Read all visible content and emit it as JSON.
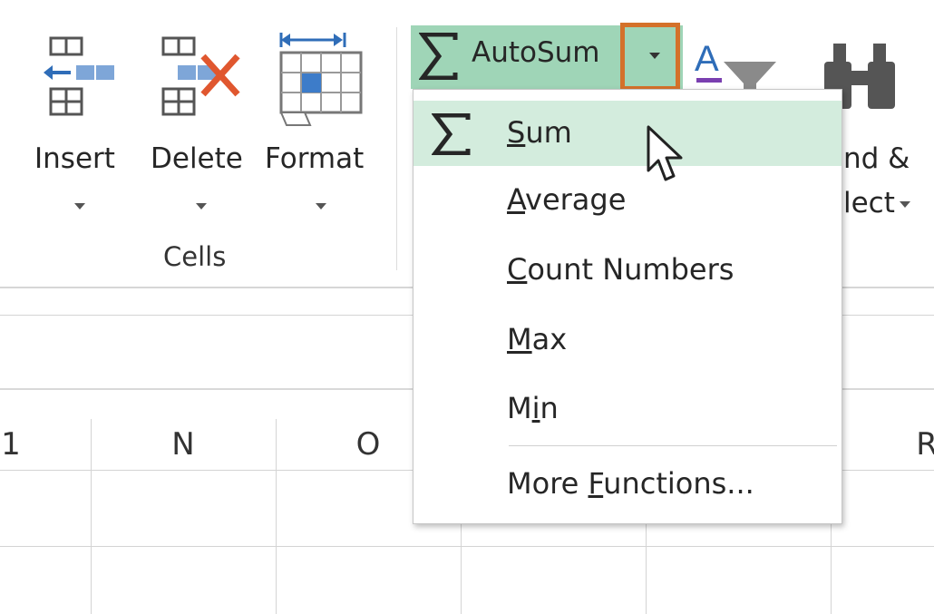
{
  "ribbon": {
    "cells_group": {
      "label": "Cells",
      "insert_label": "Insert",
      "delete_label": "Delete",
      "format_label": "Format"
    },
    "editing_group": {
      "autosum_label": "AutoSum",
      "find_select_partial_line1": "nd &",
      "find_select_partial_line2": "lect"
    }
  },
  "autosum_menu": {
    "items": [
      {
        "label": "Sum",
        "underline_index": 0,
        "hovered": true
      },
      {
        "label": "Average",
        "underline_index": 0
      },
      {
        "label": "Count Numbers",
        "underline_index": 0
      },
      {
        "label": "Max",
        "underline_index": 0
      },
      {
        "label": "Min",
        "underline_index": 1
      },
      {
        "label": "More Functions...",
        "underline_index": 5
      }
    ]
  },
  "grid": {
    "column_headers": [
      "1",
      "N",
      "O",
      "R"
    ]
  },
  "colors": {
    "autosum_bg": "#9fd5b7",
    "menu_hover": "#d3ecdd",
    "highlight_border": "#d4712a",
    "delete_x": "#e0572f",
    "table_blue": "#3d7cc9"
  }
}
